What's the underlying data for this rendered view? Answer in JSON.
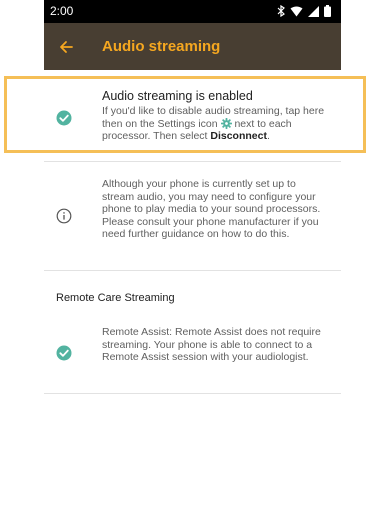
{
  "status_bar": {
    "time": "2:00"
  },
  "app_bar": {
    "back_icon": "arrow-back-icon",
    "title": "Audio streaming"
  },
  "items": [
    {
      "icon": "check-circle-icon",
      "title": "Audio streaming is enabled",
      "text_before_icon": "If you'd like to disable audio streaming, tap here then on the Settings icon",
      "inline_icon": "gear-icon",
      "text_after_icon": "next to each processor. Then select",
      "bold_text": "Disconnect",
      "end_text": "."
    },
    {
      "icon": "info-circle-icon",
      "text": "Although your phone is currently set up to stream audio, you may need to configure your phone to play media to your sound processors. Please consult your phone manufacturer if you need further guidance on how to do this."
    }
  ],
  "section": {
    "title": "Remote Care Streaming",
    "item": {
      "icon": "check-circle-icon",
      "text": "Remote Assist: Remote Assist does not require streaming. Your phone is able to connect to a Remote Assist session with your audiologist."
    }
  },
  "colors": {
    "app_bar_bg": "#483e32",
    "accent": "#f5a720",
    "check": "#52b3a0",
    "highlight": "#f5bf57"
  }
}
